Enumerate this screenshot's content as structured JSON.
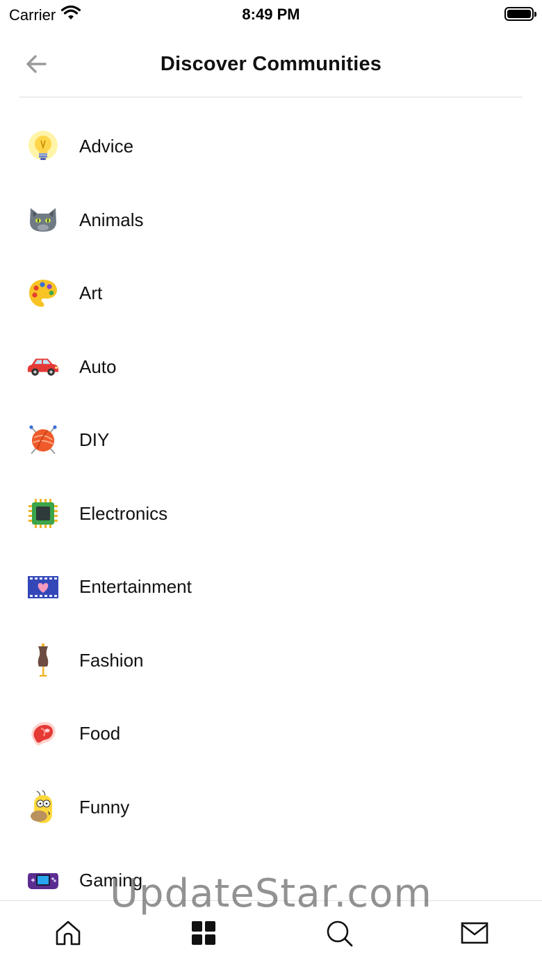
{
  "status_bar": {
    "carrier": "Carrier",
    "time": "8:49 PM"
  },
  "header": {
    "title": "Discover Communities"
  },
  "communities": [
    {
      "label": "Advice",
      "icon": "lightbulb-icon"
    },
    {
      "label": "Animals",
      "icon": "cat-icon"
    },
    {
      "label": "Art",
      "icon": "palette-icon"
    },
    {
      "label": "Auto",
      "icon": "car-icon"
    },
    {
      "label": "DIY",
      "icon": "yarn-icon"
    },
    {
      "label": "Electronics",
      "icon": "chip-icon"
    },
    {
      "label": "Entertainment",
      "icon": "film-icon"
    },
    {
      "label": "Fashion",
      "icon": "mannequin-icon"
    },
    {
      "label": "Food",
      "icon": "steak-icon"
    },
    {
      "label": "Funny",
      "icon": "cartoon-face-icon"
    },
    {
      "label": "Gaming",
      "icon": "handheld-console-icon"
    }
  ],
  "tab_bar": {
    "tabs": [
      {
        "icon": "home-icon"
      },
      {
        "icon": "grid-icon"
      },
      {
        "icon": "search-icon"
      },
      {
        "icon": "mail-icon"
      }
    ]
  },
  "watermark": "UpdateStar.com"
}
